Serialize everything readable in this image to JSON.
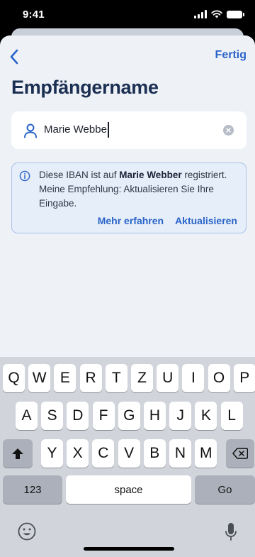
{
  "status_bar": {
    "time": "9:41"
  },
  "nav": {
    "done_label": "Fertig"
  },
  "page": {
    "title": "Empfängername"
  },
  "name_field": {
    "value": "Marie Webbe"
  },
  "notice": {
    "text_before": "Diese IBAN ist auf ",
    "highlight_name": "Marie Webber",
    "text_after": " registriert. Meine Empfehlung: Aktualisieren Sie Ihre Eingabe.",
    "learn_more_label": "Mehr erfahren",
    "update_label": "Aktualisieren"
  },
  "colors": {
    "accent": "#2a64c9",
    "title": "#1b2f52",
    "background": "#eef1f6",
    "notice_background": "#e6eef9",
    "notice_border": "#a9c2ea"
  },
  "keyboard": {
    "row1": [
      "Q",
      "W",
      "E",
      "R",
      "T",
      "Z",
      "U",
      "I",
      "O",
      "P"
    ],
    "row2": [
      "A",
      "S",
      "D",
      "F",
      "G",
      "H",
      "J",
      "K",
      "L"
    ],
    "row3": [
      "Y",
      "X",
      "C",
      "V",
      "B",
      "N",
      "M"
    ],
    "numbers_label": "123",
    "space_label": "space",
    "go_label": "Go",
    "icons": [
      "shift-icon",
      "backspace-icon",
      "emoji-icon",
      "microphone-icon"
    ]
  }
}
